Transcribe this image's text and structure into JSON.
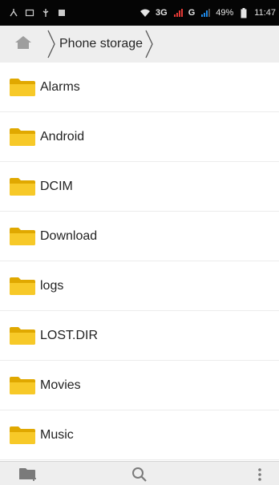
{
  "status_bar": {
    "network_3g": "3G",
    "network_g": "G",
    "battery": "49%",
    "time": "11:47",
    "icons": [
      "usb-icon",
      "screenshot-icon",
      "usb-debug-icon",
      "image-icon",
      "wifi-icon",
      "signal-icon",
      "battery-icon"
    ]
  },
  "breadcrumb": {
    "home_icon": "home-icon",
    "current": "Phone storage"
  },
  "files": [
    {
      "name": "Alarms",
      "icon": "folder-icon"
    },
    {
      "name": "Android",
      "icon": "folder-icon"
    },
    {
      "name": "DCIM",
      "icon": "folder-icon"
    },
    {
      "name": "Download",
      "icon": "folder-icon"
    },
    {
      "name": "logs",
      "icon": "folder-icon"
    },
    {
      "name": "LOST.DIR",
      "icon": "folder-icon"
    },
    {
      "name": "Movies",
      "icon": "folder-icon"
    },
    {
      "name": "Music",
      "icon": "folder-icon"
    }
  ],
  "toolbar": {
    "icons": [
      "new-folder-icon",
      "search-icon",
      "overflow-menu-icon"
    ]
  },
  "colors": {
    "folder": "#f7c928",
    "folder_dark": "#e0a800",
    "status_bar": "#050505",
    "network_3g": "#e53935",
    "network_g": "#1e88e5"
  }
}
